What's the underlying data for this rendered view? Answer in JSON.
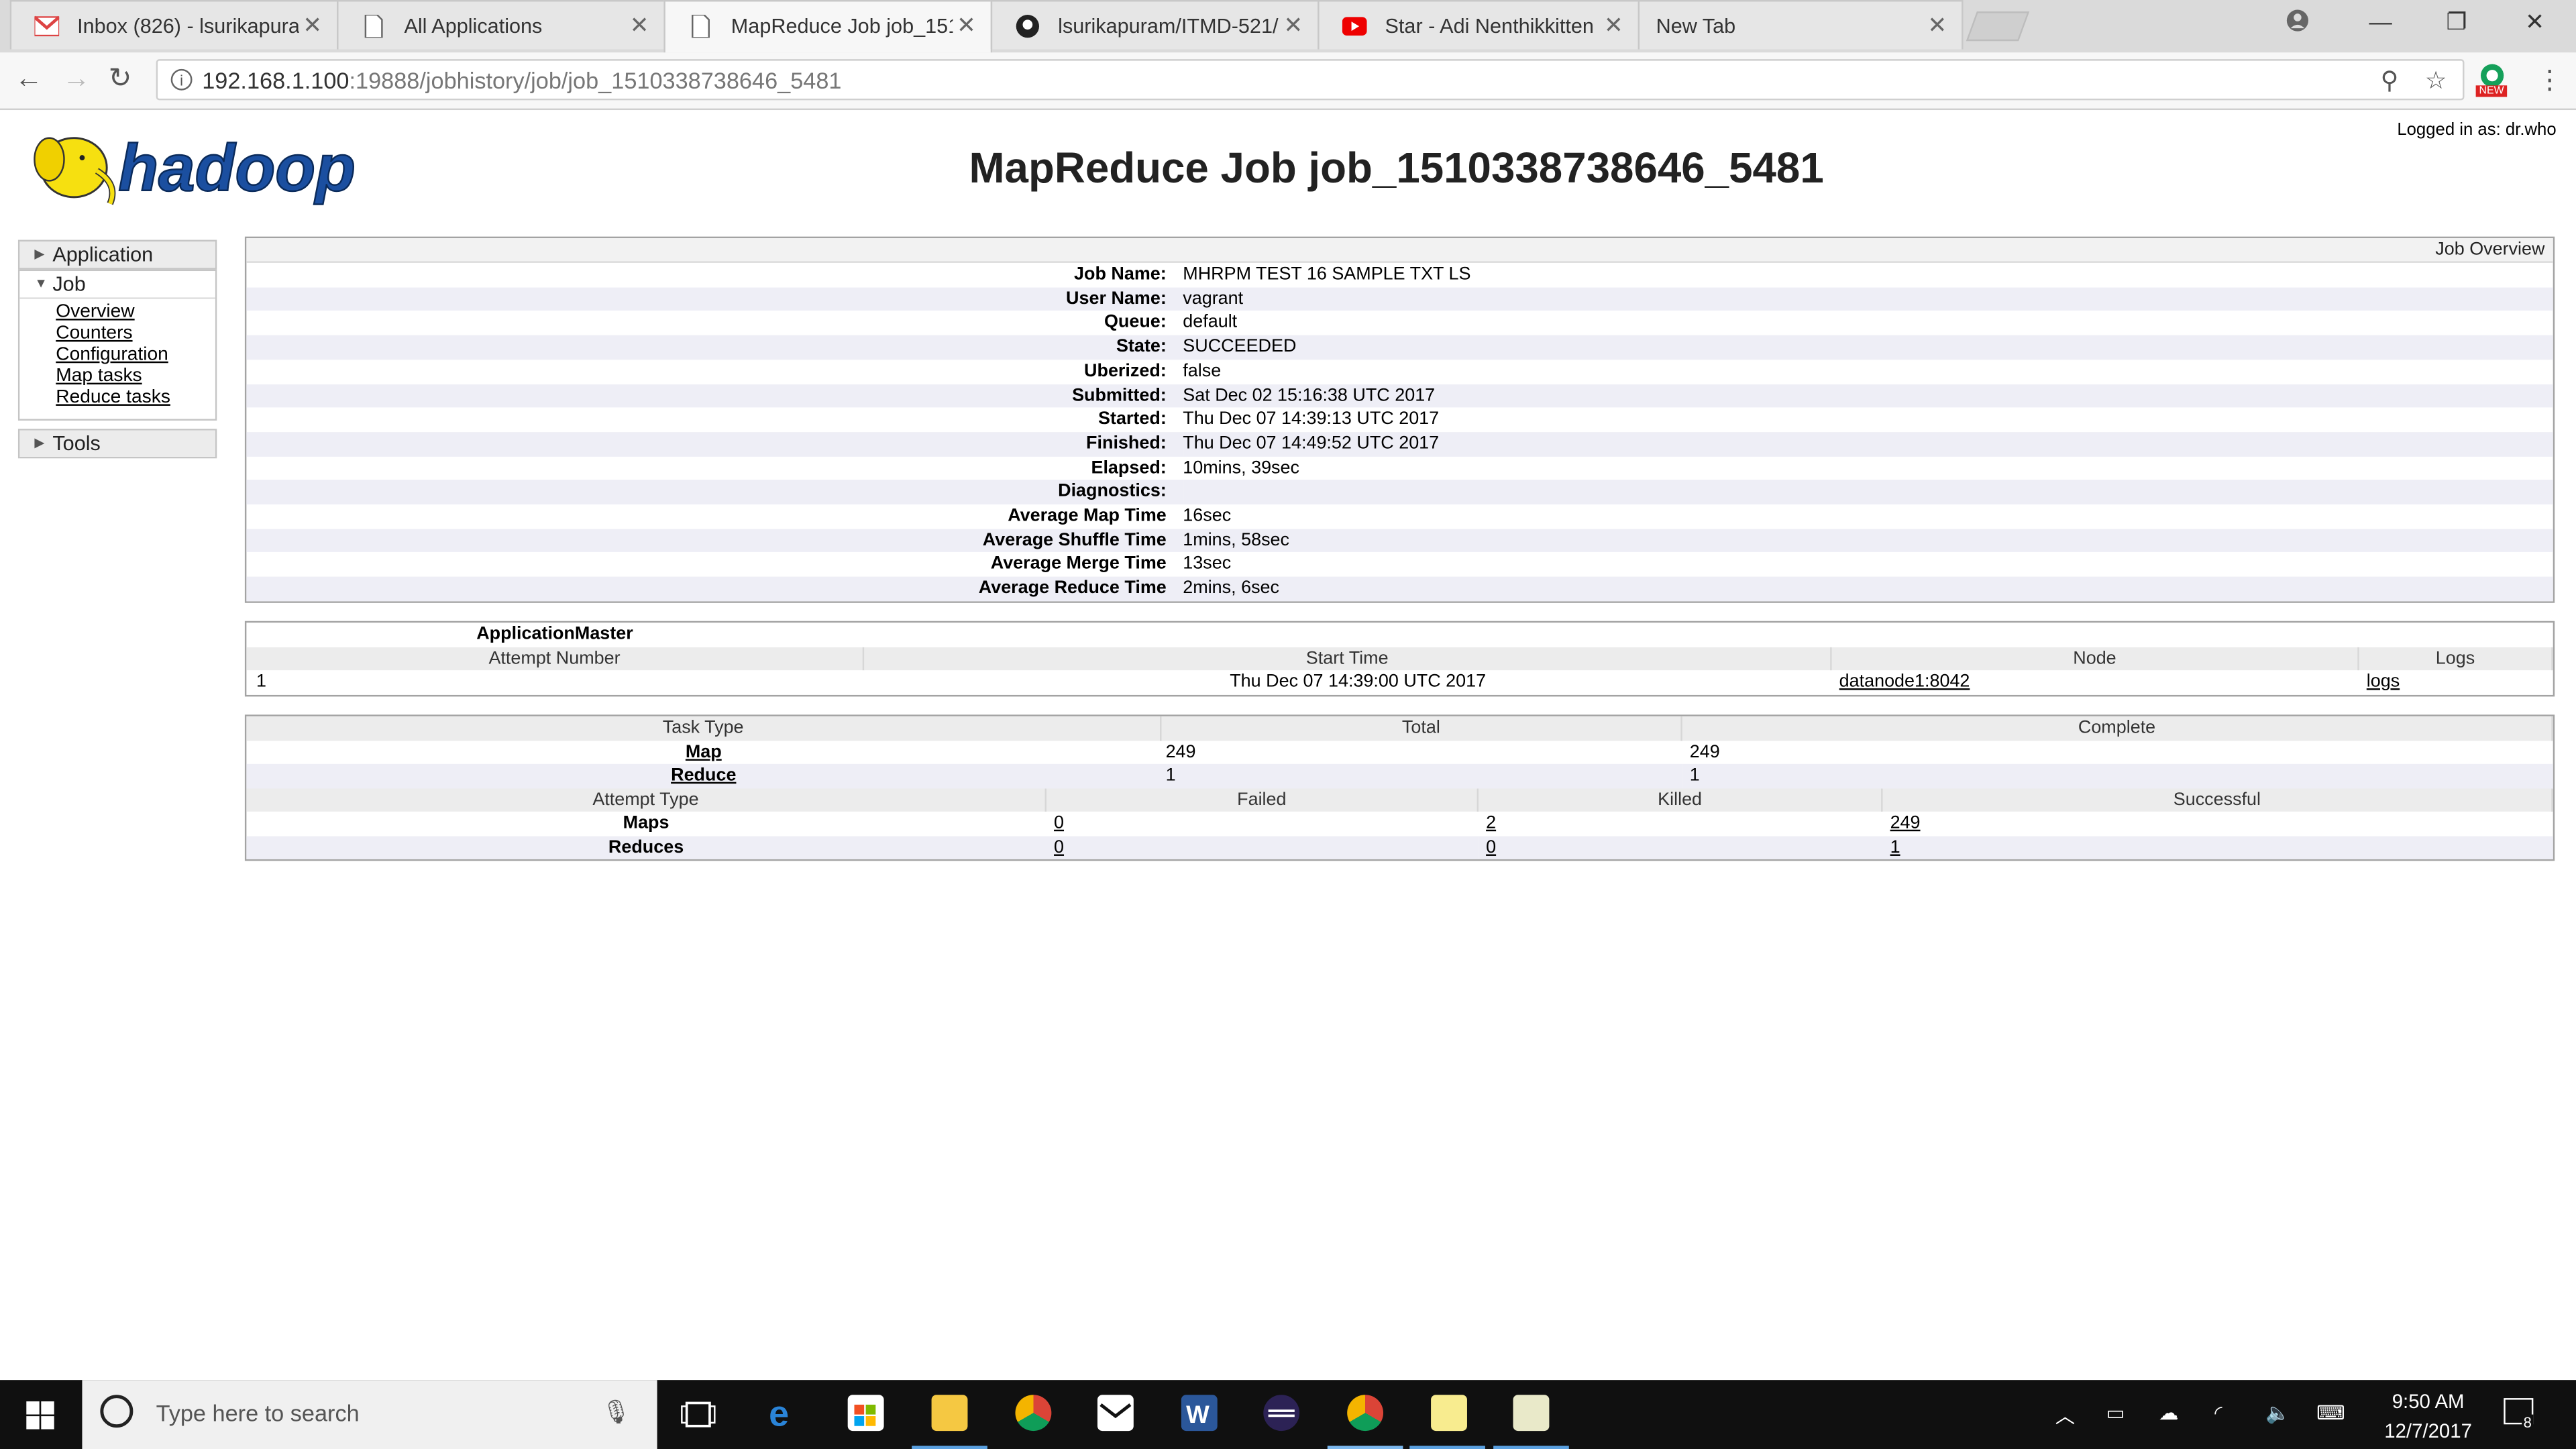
{
  "browser": {
    "tabs": [
      {
        "title": "Inbox (826) - lsurikapura",
        "icon": "gmail-icon"
      },
      {
        "title": "All Applications",
        "icon": "page-icon"
      },
      {
        "title": "MapReduce Job job_151",
        "icon": "page-icon"
      },
      {
        "title": "lsurikapuram/ITMD-521/",
        "icon": "github-icon"
      },
      {
        "title": "Star - Adi Nenthikkitten",
        "icon": "youtube-icon"
      },
      {
        "title": "New Tab",
        "icon": ""
      }
    ],
    "url_host": "192.168.1.100",
    "url_rest": ":19888/jobhistory/job/job_1510338738646_5481",
    "ext_badge": "NEW"
  },
  "page": {
    "logo_text": "hadoop",
    "logged_in": "Logged in as: dr.who",
    "title": "MapReduce Job job_1510338738646_5481"
  },
  "nav": {
    "application": "Application",
    "job": "Job",
    "job_links": [
      "Overview",
      "Counters",
      "Configuration",
      "Map tasks",
      "Reduce tasks"
    ],
    "tools": "Tools"
  },
  "overview": {
    "header": "Job Overview",
    "rows": [
      {
        "k": "Job Name:",
        "v": "MHRPM TEST 16 SAMPLE TXT LS"
      },
      {
        "k": "User Name:",
        "v": "vagrant"
      },
      {
        "k": "Queue:",
        "v": "default"
      },
      {
        "k": "State:",
        "v": "SUCCEEDED"
      },
      {
        "k": "Uberized:",
        "v": "false"
      },
      {
        "k": "Submitted:",
        "v": "Sat Dec 02 15:16:38 UTC 2017"
      },
      {
        "k": "Started:",
        "v": "Thu Dec 07 14:39:13 UTC 2017"
      },
      {
        "k": "Finished:",
        "v": "Thu Dec 07 14:49:52 UTC 2017"
      },
      {
        "k": "Elapsed:",
        "v": "10mins, 39sec"
      },
      {
        "k": "Diagnostics:",
        "v": ""
      },
      {
        "k": "Average Map Time",
        "v": "16sec"
      },
      {
        "k": "Average Shuffle Time",
        "v": "1mins, 58sec"
      },
      {
        "k": "Average Merge Time",
        "v": "13sec"
      },
      {
        "k": "Average Reduce Time",
        "v": "2mins, 6sec"
      }
    ]
  },
  "am": {
    "title": "ApplicationMaster",
    "headers": [
      "Attempt Number",
      "Start Time",
      "Node",
      "Logs"
    ],
    "row": {
      "attempt": "1",
      "start": "Thu Dec 07 14:39:00 UTC 2017",
      "node": "datanode1:8042",
      "logs": "logs"
    }
  },
  "tasks": {
    "headers": [
      "Task Type",
      "Total",
      "Complete"
    ],
    "rows": [
      {
        "type": "Map",
        "total": "249",
        "complete": "249"
      },
      {
        "type": "Reduce",
        "total": "1",
        "complete": "1"
      }
    ],
    "attempt_headers": [
      "Attempt Type",
      "Failed",
      "Killed",
      "Successful"
    ],
    "attempt_rows": [
      {
        "type": "Maps",
        "failed": "0",
        "killed": "2",
        "successful": "249"
      },
      {
        "type": "Reduces",
        "failed": "0",
        "killed": "0",
        "successful": "1"
      }
    ]
  },
  "taskbar": {
    "search_placeholder": "Type here to search",
    "time": "9:50 AM",
    "date": "12/7/2017",
    "notification_count": "8"
  }
}
